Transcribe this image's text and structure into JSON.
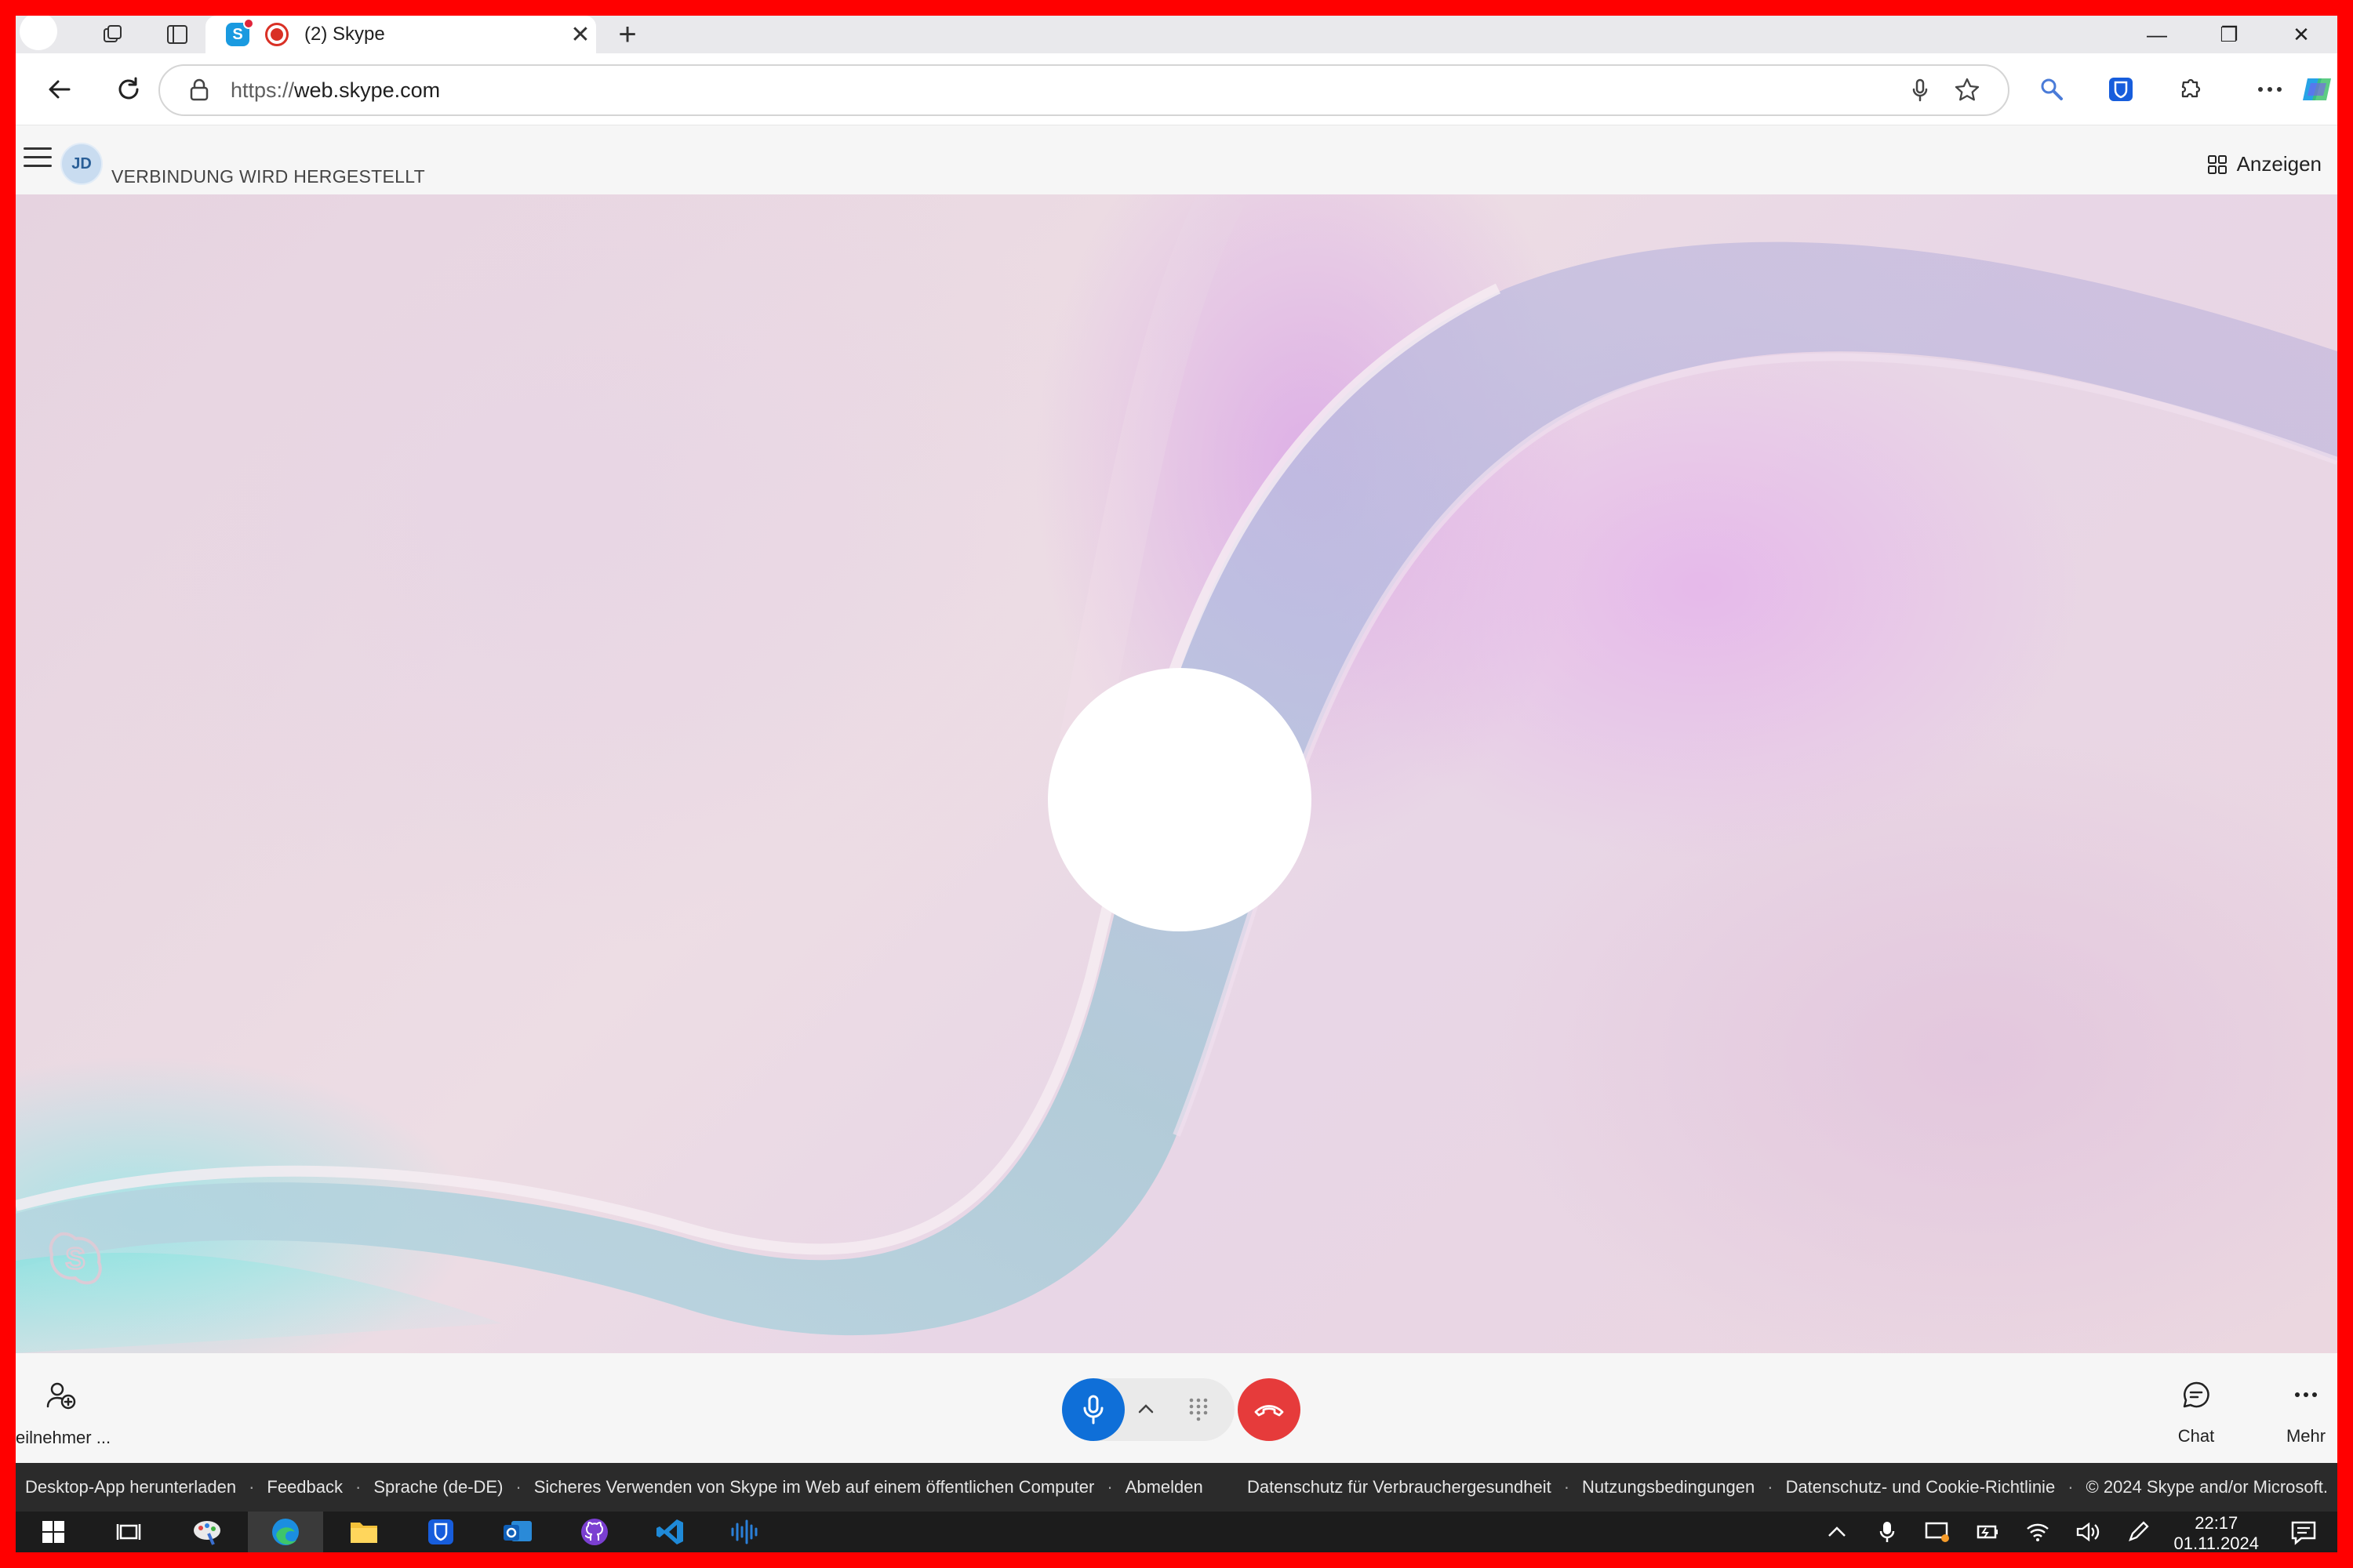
{
  "browser": {
    "tab_title": "(2) Skype",
    "url_protocol": "https://",
    "url_host": "web.skype.com",
    "tab_close": "✕",
    "new_tab": "+",
    "window_controls": [
      "—",
      "❐",
      "✕"
    ]
  },
  "skype": {
    "avatar_initials": "JD",
    "call_status": "VERBINDUNG WIRD HERGESTELLT",
    "view_label": "Anzeigen"
  },
  "controls": {
    "participants_label": "eilnehmer ...",
    "chat_label": "Chat",
    "more_label": "Mehr",
    "mic_chevron": "^"
  },
  "footer": {
    "left_links": [
      "Desktop-App herunterladen",
      "Feedback",
      "Sprache (de-DE)",
      "Sicheres Verwenden von Skype im Web auf einem öffentlichen Computer",
      "Abmelden"
    ],
    "right_links": [
      "Datenschutz für Verbrauchergesundheit",
      "Nutzungsbedingungen",
      "Datenschutz- und Cookie-Richtlinie",
      "© 2024 Skype and/or Microsoft."
    ],
    "separator": "·"
  },
  "taskbar": {
    "time": "22:17",
    "date": "01.11.2024"
  },
  "colors": {
    "accent_blue": "#0f6fd8",
    "hangup_red": "#e63b3b",
    "border_red": "#ff0000"
  },
  "icons": [
    "back-arrow-icon",
    "refresh-icon",
    "lock-icon",
    "microphone-icon",
    "star-icon",
    "search-icon",
    "bitwarden-icon",
    "extensions-icon",
    "more-icon",
    "copilot-icon",
    "grid-icon",
    "add-person-icon",
    "chat-icon",
    "dialpad-icon",
    "hangup-icon"
  ]
}
